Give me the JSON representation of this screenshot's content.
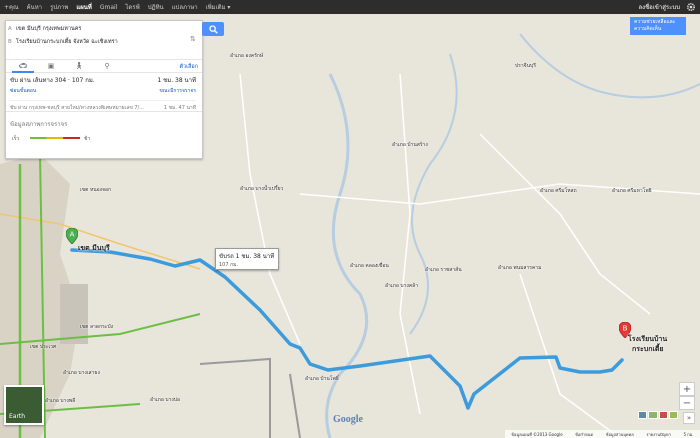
{
  "topbar": {
    "items": [
      "+คุณ",
      "ค้นหา",
      "รูปภาพ",
      "แผนที่",
      "Gmail",
      "ไดรฟ์",
      "ปฏิทิน",
      "แปลภาษา",
      "เพิ่มเติม ▾"
    ],
    "active_index": 3,
    "signin_label": "ลงชื่อเข้าสู่ระบบ"
  },
  "promo": {
    "text": "ความช่วยเหลือและความคิดเห็น"
  },
  "directions": {
    "origin_letter": "A",
    "origin": "เขต มีนบุรี กรุงเทพมหานคร",
    "destination_letter": "B",
    "destination": "โรงเรียนบ้านกระบกเตี้ย จังหวัด ฉะเชิงเทรา",
    "options_label": "ตัวเลือก",
    "route1": {
      "title": "ขับ ผ่าน เส้นทาง 304 · 107 กม.",
      "time": "1 ชม. 38 นาที",
      "link_left": "ซ่อนขั้นตอน",
      "link_right": "ขณะมีการจราจร"
    },
    "route2": {
      "title": "ขับ ผ่าน กรุงเทพ-ชลบุรี สายใหม่/ทางหลวงพิเศษหมายเลข 7/...",
      "time": "1 ชม. 47 นาที"
    },
    "traffic": {
      "title": "ข้อมูลสภาพการจราจร",
      "fast": "เร็ว",
      "slow": "ช้า",
      "colors": [
        "#6cbe45",
        "#f0b400",
        "#c52c20"
      ]
    }
  },
  "map": {
    "route_color": "#3b9bdc",
    "duration_box": {
      "line1": "ขับรถ 1 ชม. 38 นาที",
      "line2": "107 กม."
    },
    "marker_a": {
      "letter": "A",
      "label": "เขต มีนบุรี"
    },
    "marker_b": {
      "letter": "B",
      "label_line1": "โรงเรียนบ้าน",
      "label_line2": "กระบกเตี้ย"
    },
    "places": [
      "อำเภอ องครักษ์",
      "อำเภอ บ้านสร้าง",
      "อำเภอ บางน้ำเปรี้ยว",
      "อำเภอ ศรีมโหสถ",
      "อำเภอ ศรีมหาโพธิ",
      "อำเภอ คลองเขื่อน",
      "อำเภอ ราชสาส์น",
      "อำเภอ พนมสารคาม",
      "อำเภอ บางคล้า",
      "อำเภอ บ้านโพธิ์",
      "อำเภอ บางเสาธง",
      "อำเภอ บางพลี",
      "อำเภอ บางบ่อ",
      "เขต หนองจอก",
      "เขต ลาดกระบัง",
      "เขต ประเวศ",
      "ปราจีนบุรี"
    ],
    "earth_label": "Earth",
    "google_logo": "Google",
    "zoom_in": "+",
    "zoom_out": "−"
  },
  "footer": {
    "items": [
      "ข้อมูลแผนที่ ©2013 Google",
      "ข้อกำหนด",
      "ข้อมูลส่วนบุคคล",
      "รายงานปัญหา",
      "5 กม."
    ]
  }
}
